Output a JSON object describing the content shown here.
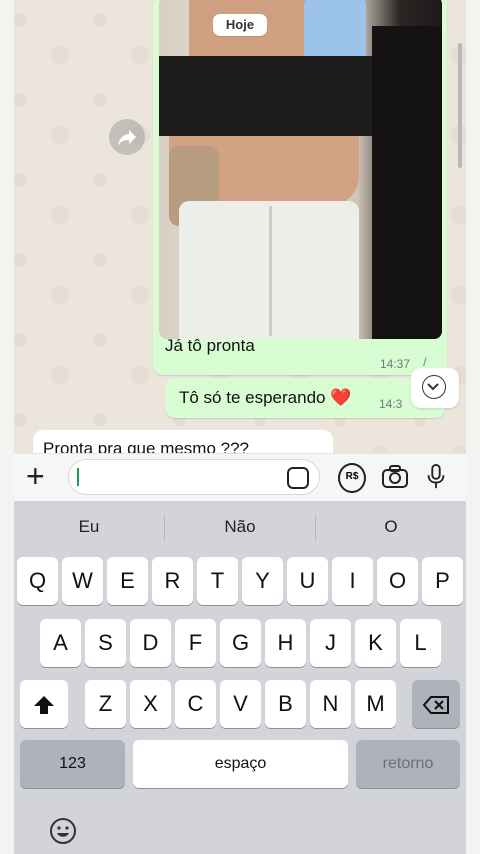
{
  "chat": {
    "date_chip": "Hoje",
    "image_message": {
      "caption": "Já tô pronta",
      "time": "14:37",
      "ticks": "//"
    },
    "message_sent": {
      "text": "Tô só te esperando ❤️",
      "time": "14:3"
    },
    "message_received_partial": {
      "text": "Pronta pra que mesmo ???"
    }
  },
  "input_bar": {
    "value": "",
    "currency_label": "R$"
  },
  "keyboard": {
    "suggestions": [
      "Eu",
      "Não",
      "O"
    ],
    "row1": [
      "Q",
      "W",
      "E",
      "R",
      "T",
      "Y",
      "U",
      "I",
      "O",
      "P"
    ],
    "row2": [
      "A",
      "S",
      "D",
      "F",
      "G",
      "H",
      "J",
      "K",
      "L"
    ],
    "row3": [
      "Z",
      "X",
      "C",
      "V",
      "B",
      "N",
      "M"
    ],
    "numbers_key": "123",
    "space_key": "espaço",
    "return_key": "retorno"
  },
  "colors": {
    "bubble_out": "#d9fdd3",
    "bubble_in": "#ffffff",
    "caret": "#1aa34a",
    "keyboard_bg": "#d2d4d9"
  }
}
